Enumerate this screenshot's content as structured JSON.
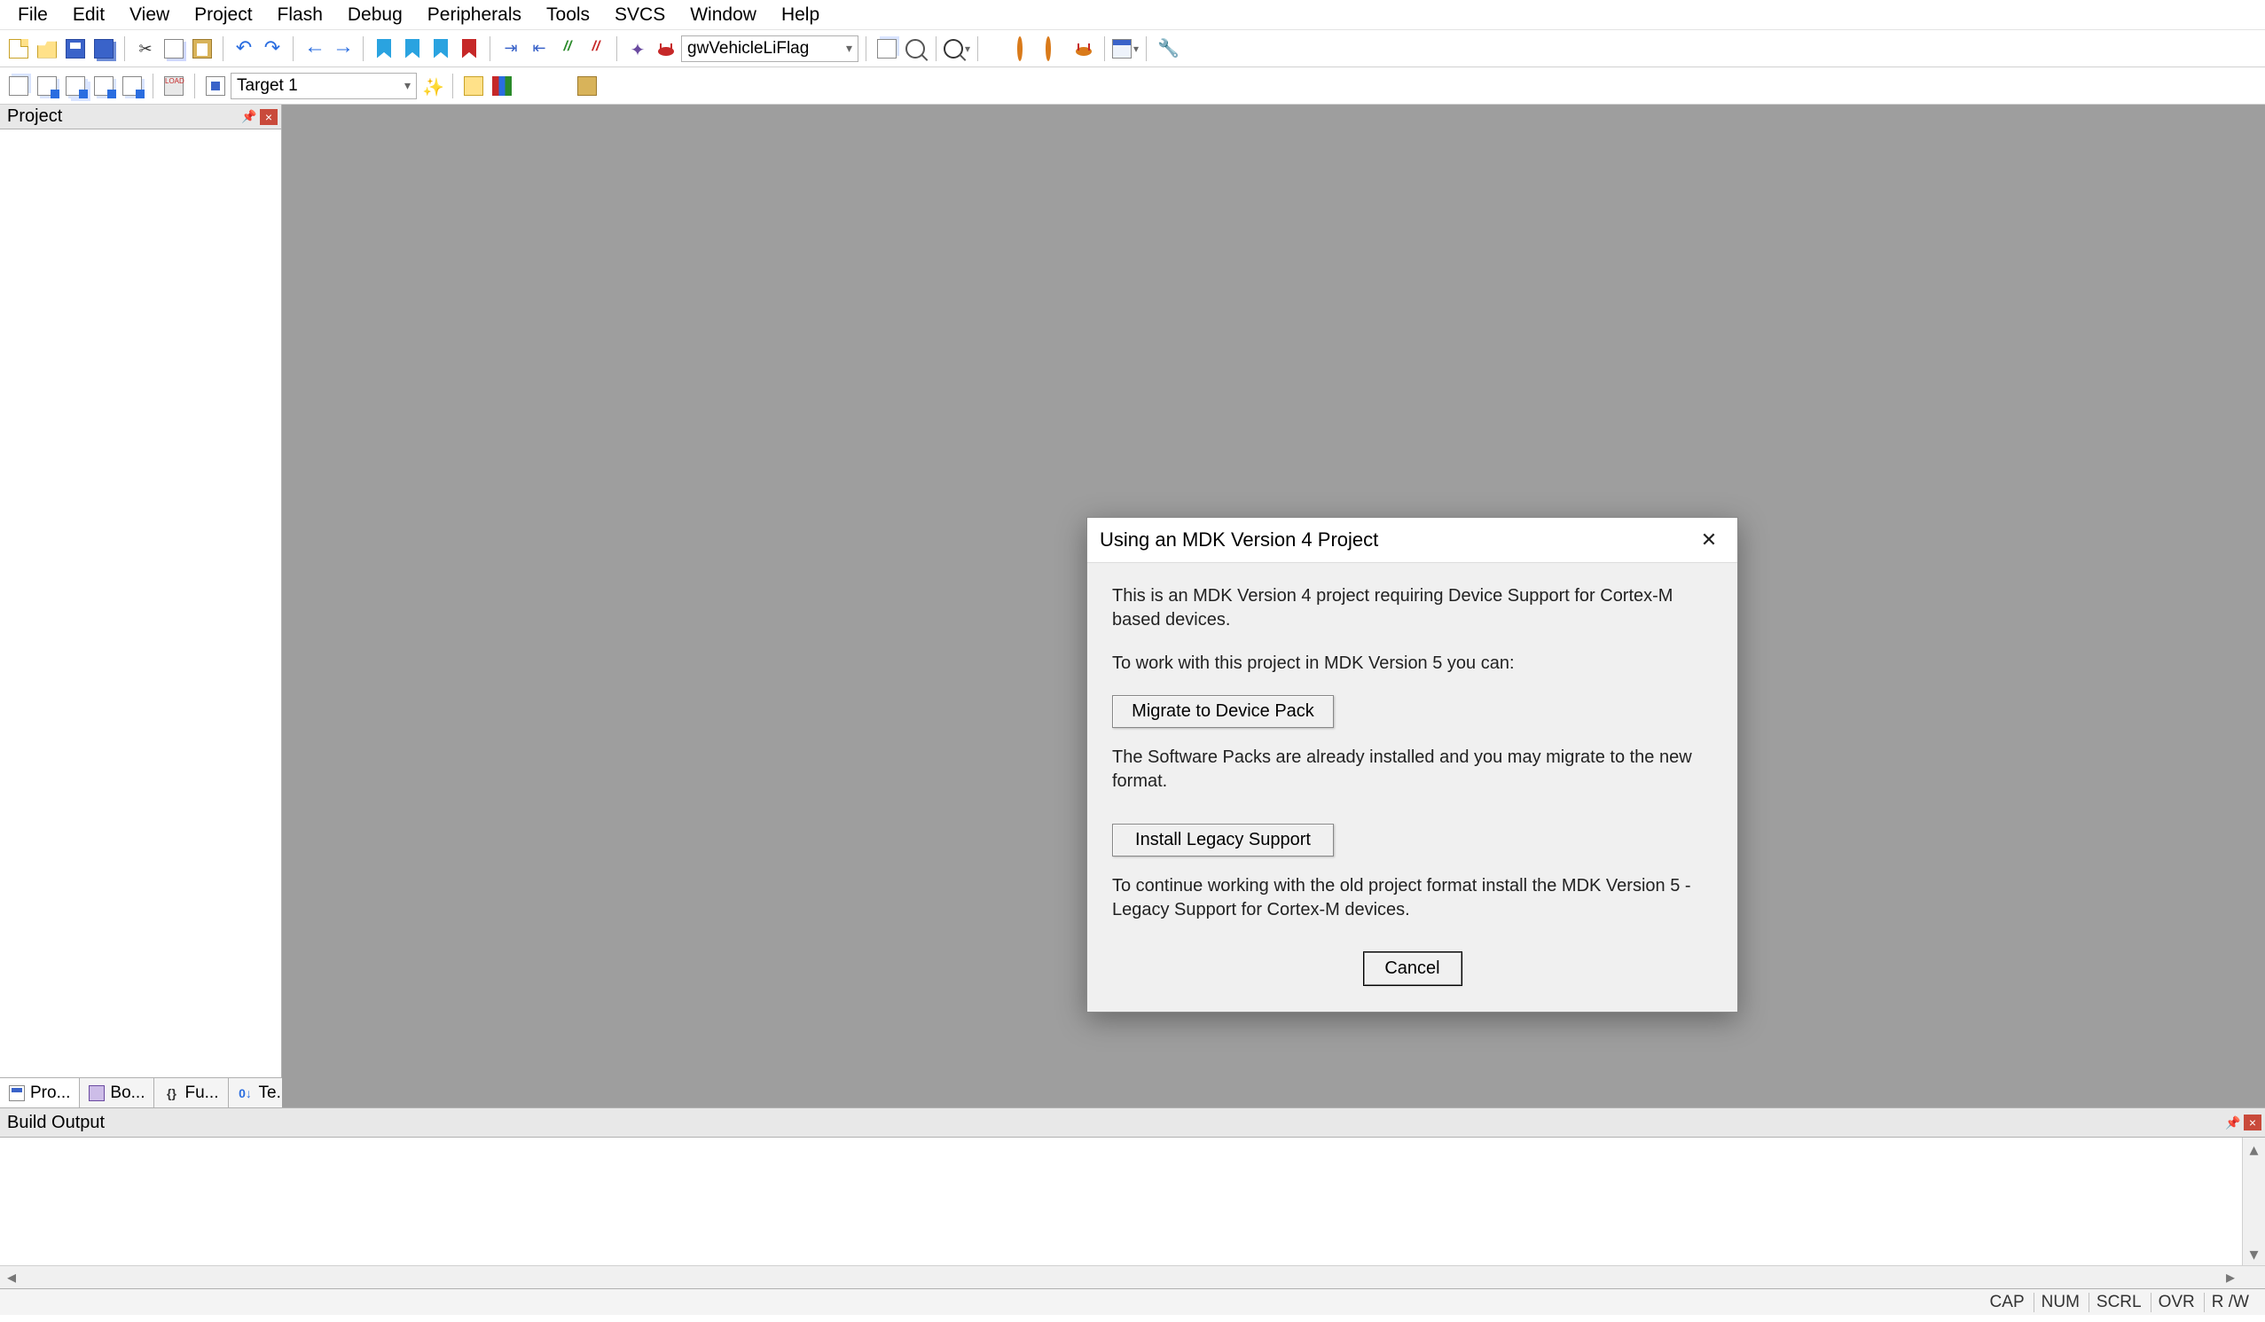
{
  "menu": {
    "items": [
      "File",
      "Edit",
      "View",
      "Project",
      "Flash",
      "Debug",
      "Peripherals",
      "Tools",
      "SVCS",
      "Window",
      "Help"
    ]
  },
  "toolbar1": {
    "search_value": "gwVehicleLiFlag"
  },
  "toolbar2": {
    "target_value": "Target 1"
  },
  "panels": {
    "project": {
      "title": "Project",
      "tabs": [
        "Pro...",
        "Bo...",
        "Fu...",
        "Te..."
      ]
    },
    "build": {
      "title": "Build Output"
    }
  },
  "dialog": {
    "title": "Using an MDK Version 4 Project",
    "intro": "This is an MDK Version 4 project requiring Device Support for Cortex-M based devices.",
    "lead": "To work with this project in MDK Version 5 you can:",
    "migrate_btn": "Migrate to Device Pack",
    "migrate_txt": "The Software Packs are already installed and you may migrate to the new format.",
    "legacy_btn": "Install Legacy Support",
    "legacy_txt": "To continue working with the old project format install the MDK Version 5 - Legacy Support for Cortex-M devices.",
    "cancel_btn": "Cancel"
  },
  "status": {
    "items": [
      "CAP",
      "NUM",
      "SCRL",
      "OVR",
      "R /W"
    ]
  }
}
